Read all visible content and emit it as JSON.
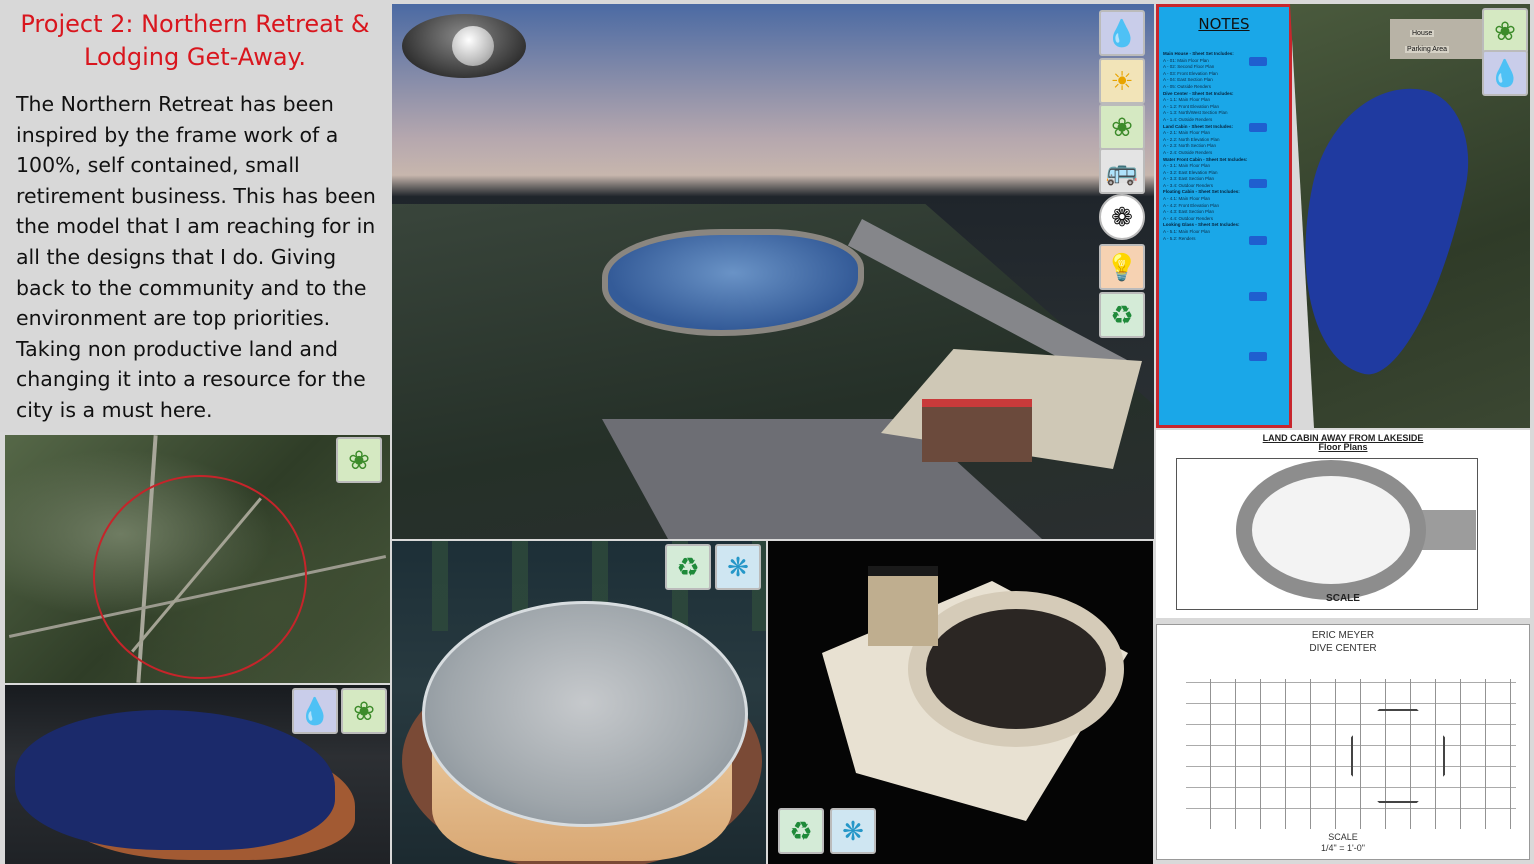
{
  "title": {
    "line1": "Project 2: Northern Retreat &",
    "line2": "Lodging Get-Away."
  },
  "description": "The Northern Retreat has been inspired by the frame work of a 100%, self contained, small retirement business. This has been the model that I am reaching for in all the designs that I do. Giving back to the community and to the environment are top priorities. Taking non productive land and changing it into a resource for the city is a must here.",
  "notes": {
    "title": "NOTES",
    "items": [
      {
        "text": "Main House - Sheet Set Includes:",
        "head": true
      },
      {
        "text": "A - 01: Main Floor Plan",
        "head": false
      },
      {
        "text": "A - 02: Second Floor Plan",
        "head": false
      },
      {
        "text": "A - 03: Front Elevation Plan",
        "head": false
      },
      {
        "text": "A - 04: East Section Plan",
        "head": false
      },
      {
        "text": "A - 05: Outside Renders",
        "head": false
      },
      {
        "text": "Dive Center - Sheet Set Includes:",
        "head": true
      },
      {
        "text": "A - 1.1: Main Floor Plan",
        "head": false
      },
      {
        "text": "A - 1.2: Front Elevation Plan",
        "head": false
      },
      {
        "text": "A - 1.3: North/West Section Plan",
        "head": false
      },
      {
        "text": "A - 1.4: Outside Renders",
        "head": false
      },
      {
        "text": "Land Cabin - Sheet Set Includes:",
        "head": true
      },
      {
        "text": "A - 2.1: Main Floor Plan",
        "head": false
      },
      {
        "text": "A - 2.2: North Elevation Plan",
        "head": false
      },
      {
        "text": "A - 2.3: North Section Plan",
        "head": false
      },
      {
        "text": "A - 2.4: Outside Renders",
        "head": false
      },
      {
        "text": "Water Front Cabin - Sheet Set Includes:",
        "head": true
      },
      {
        "text": "A - 3.1: Main Floor Plan",
        "head": false
      },
      {
        "text": "A - 3.2: East Elevation Plan",
        "head": false
      },
      {
        "text": "A - 3.3: East Section Plan",
        "head": false
      },
      {
        "text": "A - 3.4: Outdoor Renders",
        "head": false
      },
      {
        "text": "Floating Cabin - Sheet Set Includes:",
        "head": true
      },
      {
        "text": "A - 4.1: Main Floor Plan",
        "head": false
      },
      {
        "text": "A - 4.2: Front Elevation Plan",
        "head": false
      },
      {
        "text": "A - 4.3: East Section Plan",
        "head": false
      },
      {
        "text": "A - 4.4: Outdoor Renders",
        "head": false
      },
      {
        "text": "Looking Glass - Sheet Set Includes:",
        "head": true
      },
      {
        "text": "A - 5.1: Main Floor Plan",
        "head": false
      },
      {
        "text": "A - 5.2: Renders",
        "head": false
      }
    ]
  },
  "site_plan": {
    "house_label": "House",
    "parking_label": "Parking Area"
  },
  "cabin_plan": {
    "title": "LAND CABIN AWAY FROM LAKESIDE",
    "subtitle": "Floor Plans",
    "scale_label": "SCALE"
  },
  "dive_plan": {
    "title": "ERIC MEYER",
    "subtitle": "DIVE CENTER",
    "scale_label": "SCALE",
    "scale_ratio": "1/4\" = 1'-0\""
  },
  "badges": {
    "water": "water-efficiency-icon",
    "energy": "energy-atmosphere-icon",
    "site": "sustainable-sites-icon",
    "transport": "transportation-icon",
    "leed": "leed-seal-icon",
    "innovation": "innovation-icon",
    "materials": "materials-resources-icon",
    "air": "indoor-environmental-quality-icon"
  },
  "colors": {
    "title_red": "#d9161e",
    "notes_blue": "#1aa7e8",
    "notes_border": "#c8262d",
    "panel_gray": "#d8d8d8"
  }
}
